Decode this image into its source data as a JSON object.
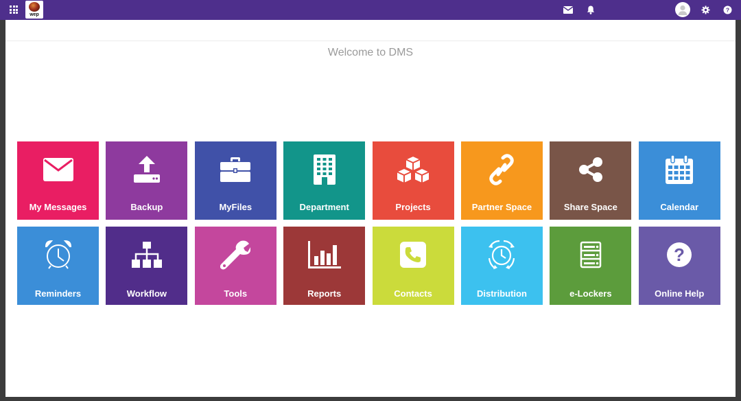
{
  "topbar": {
    "color": "#4e2f8c",
    "icons": [
      "apps-grid-icon",
      "logo",
      "mail-icon",
      "bell-icon",
      "avatar",
      "gear-icon",
      "help-icon"
    ],
    "logo_text": "wep"
  },
  "main": {
    "welcome": "Welcome to DMS"
  },
  "tiles": [
    {
      "label": "My Messages",
      "icon": "envelope-icon",
      "color": "#e91e63"
    },
    {
      "label": "Backup",
      "icon": "upload-icon",
      "color": "#8e3a9e"
    },
    {
      "label": "MyFiles",
      "icon": "briefcase-icon",
      "color": "#4051a8"
    },
    {
      "label": "Department",
      "icon": "building-icon",
      "color": "#12958a"
    },
    {
      "label": "Projects",
      "icon": "cubes-icon",
      "color": "#e84c3d"
    },
    {
      "label": "Partner Space",
      "icon": "link-icon",
      "color": "#f7981d"
    },
    {
      "label": "Share Space",
      "icon": "share-icon",
      "color": "#795548"
    },
    {
      "label": "Calendar",
      "icon": "calendar-icon",
      "color": "#3b8ed8"
    },
    {
      "label": "Reminders",
      "icon": "alarm-clock-icon",
      "color": "#3b8ed8"
    },
    {
      "label": "Workflow",
      "icon": "sitemap-icon",
      "color": "#512d8a"
    },
    {
      "label": "Tools",
      "icon": "wrench-icon",
      "color": "#c4479d"
    },
    {
      "label": "Reports",
      "icon": "bar-chart-icon",
      "color": "#9c3838"
    },
    {
      "label": "Contacts",
      "icon": "phone-icon",
      "color": "#cbdb3b"
    },
    {
      "label": "Distribution",
      "icon": "distribution-clock-icon",
      "color": "#3cc1ef"
    },
    {
      "label": "e-Lockers",
      "icon": "server-icon",
      "color": "#5c9c3c"
    },
    {
      "label": "Online Help",
      "icon": "question-circle-icon",
      "color": "#6a5aa8"
    }
  ]
}
